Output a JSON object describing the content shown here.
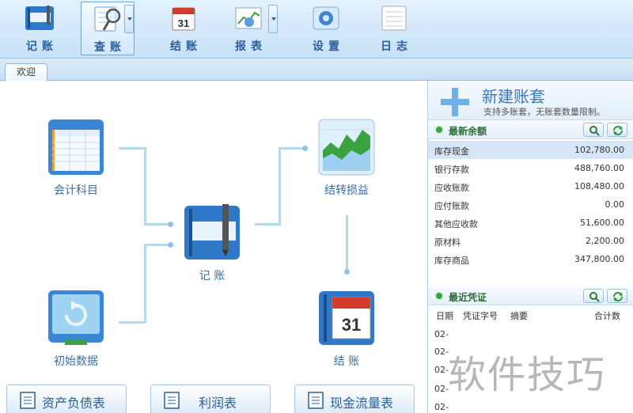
{
  "toolbar": {
    "items": [
      {
        "label": "记账",
        "icon": "ledger-book-icon"
      },
      {
        "label": "查账",
        "icon": "magnifier-icon"
      },
      {
        "label": "结账",
        "icon": "calendar-icon"
      },
      {
        "label": "报表",
        "icon": "chart-report-icon"
      },
      {
        "label": "设置",
        "icon": "gear-icon"
      },
      {
        "label": "日志",
        "icon": "log-icon"
      }
    ],
    "calendar_day": "31"
  },
  "tabs": [
    {
      "label": "欢迎"
    }
  ],
  "flow": {
    "accounts": "会计科目",
    "transfer": "结转损益",
    "bookkeeping": "记 账",
    "initial": "初始数据",
    "closing": "结 账",
    "calendar_day": "31"
  },
  "reports": [
    {
      "label": "资产负债表"
    },
    {
      "label": "利润表"
    },
    {
      "label": "现金流量表"
    }
  ],
  "new_set": {
    "title": "新建账套",
    "subtitle": "支持多账套，无账套数量限制。"
  },
  "balances": {
    "title": "最新余额",
    "rows": [
      {
        "name": "库存现金",
        "value": "102,780.00"
      },
      {
        "name": "银行存款",
        "value": "488,760.00"
      },
      {
        "name": "应收账款",
        "value": "108,480.00"
      },
      {
        "name": "应付账款",
        "value": "0.00"
      },
      {
        "name": "其他应收款",
        "value": "51,600.00"
      },
      {
        "name": "原材料",
        "value": "2,200.00"
      },
      {
        "name": "库存商品",
        "value": "347,800.00"
      }
    ]
  },
  "vouchers": {
    "title": "最近凭证",
    "headers": {
      "date": "日期",
      "number": "凭证字号",
      "summary": "摘要",
      "total": "合计数"
    },
    "rows": [
      "02-",
      "02-",
      "02-",
      "02-",
      "02-"
    ]
  },
  "watermark": "软件技巧",
  "colors": {
    "accent": "#2b5f99",
    "green": "#3aa14a",
    "toolbar_bg": "#c6e1f8"
  }
}
